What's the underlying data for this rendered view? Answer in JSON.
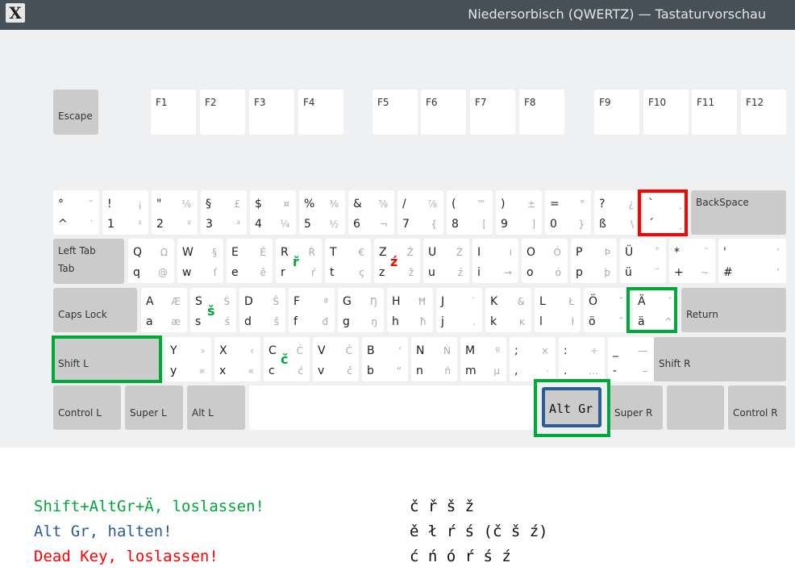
{
  "window": {
    "title": "Niedersorbisch (QWERTZ) — Tastaturvorschau",
    "icon": "x-app-icon"
  },
  "colors": {
    "green": "#00a83a",
    "blue": "#2b5c95",
    "red": "#ff0000"
  },
  "function_row": [
    "Escape",
    "F1",
    "F2",
    "F3",
    "F4",
    "F5",
    "F6",
    "F7",
    "F8",
    "F9",
    "F10",
    "F11",
    "F12"
  ],
  "number_row": [
    [
      "°",
      "^",
      "″",
      "′"
    ],
    [
      "!",
      "1",
      "¡",
      "¹"
    ],
    [
      "\"",
      "2",
      "⅛",
      "²"
    ],
    [
      "§",
      "3",
      "£",
      "³"
    ],
    [
      "$",
      "4",
      "¤",
      "¼"
    ],
    [
      "%",
      "5",
      "⅜",
      "½"
    ],
    [
      "&",
      "6",
      "⅝",
      "¬"
    ],
    [
      "/",
      "7",
      "⅞",
      "{"
    ],
    [
      "(",
      "8",
      "™",
      "["
    ],
    [
      ")",
      "9",
      "±",
      "]"
    ],
    [
      "=",
      "0",
      "°",
      "}"
    ],
    [
      "?",
      "ß",
      "¿",
      "\\"
    ],
    [
      "`",
      "´",
      "˛",
      "¸"
    ]
  ],
  "backspace": "BackSpace",
  "tab": {
    "top": "Left Tab",
    "bottom": "Tab"
  },
  "q_row": [
    [
      "Q",
      "q",
      "Ω",
      "@"
    ],
    [
      "W",
      "w",
      "§",
      "ſ"
    ],
    [
      "E",
      "e",
      "Ě",
      "ě"
    ],
    [
      "R",
      "r",
      "Ŕ",
      "ŕ"
    ],
    [
      "T",
      "t",
      "€",
      "ç"
    ],
    [
      "Z",
      "z",
      "Ž",
      "ž"
    ],
    [
      "U",
      "u",
      "Ź",
      "ź"
    ],
    [
      "I",
      "i",
      "ı",
      "→"
    ],
    [
      "O",
      "o",
      "Ó",
      "ó"
    ],
    [
      "P",
      "p",
      "Þ",
      "þ"
    ],
    [
      "Ü",
      "ü",
      "˚",
      "¨"
    ],
    [
      "*",
      "+",
      "¯",
      "~"
    ],
    [
      "'",
      "#",
      "’",
      "’"
    ]
  ],
  "caps": "Caps Lock",
  "a_row": [
    [
      "A",
      "a",
      "Æ",
      "æ"
    ],
    [
      "S",
      "s",
      "Ś",
      "ś"
    ],
    [
      "D",
      "d",
      "Š",
      "š"
    ],
    [
      "F",
      "f",
      "ª",
      "đ"
    ],
    [
      "G",
      "g",
      "Ŋ",
      "ŋ"
    ],
    [
      "H",
      "h",
      "Ħ",
      "ħ"
    ],
    [
      "J",
      "j",
      "˙",
      ". "
    ],
    [
      "K",
      "k",
      "&",
      "ĸ"
    ],
    [
      "L",
      "l",
      "Ł",
      "ł"
    ],
    [
      "Ö",
      "ö",
      "˝",
      "˝"
    ],
    [
      "Ä",
      "ä",
      "ˇ",
      "^"
    ]
  ],
  "return": "Return",
  "shift_l": "Shift L",
  "y_row": [
    [
      "Y",
      "y",
      "›",
      "»"
    ],
    [
      "X",
      "x",
      "‹",
      "«"
    ],
    [
      "C",
      "c",
      "Ć",
      "ć"
    ],
    [
      "V",
      "v",
      "Č",
      "č"
    ],
    [
      "B",
      "b",
      "‘",
      "“"
    ],
    [
      "N",
      "n",
      "Ń",
      "ń"
    ],
    [
      "M",
      "m",
      "º",
      "µ"
    ],
    [
      ";",
      ",",
      "×",
      "·"
    ],
    [
      ":",
      ".",
      "÷",
      "…"
    ],
    [
      "_",
      "-",
      "—",
      "–"
    ]
  ],
  "shift_r": "Shift R",
  "bottom_row": {
    "control_l": "Control L",
    "super_l": "Super L",
    "alt_l": "Alt L",
    "space": "",
    "alt_gr": "Alt Gr",
    "super_r": "Super R",
    "menu": "",
    "control_r": "Control R"
  },
  "overlays": {
    "r": "ř",
    "z": "ź",
    "s": "š",
    "c": "č"
  },
  "footer": [
    {
      "instruction": "Shift+AltGr+Ä, loslassen!",
      "result": "č ř š ž"
    },
    {
      "instruction": "Alt Gr, halten!",
      "result": "ě ł ŕ ś (č š ź)"
    },
    {
      "instruction": "Dead Key, loslassen!",
      "result": "ć ń ó ŕ ś ź"
    }
  ]
}
